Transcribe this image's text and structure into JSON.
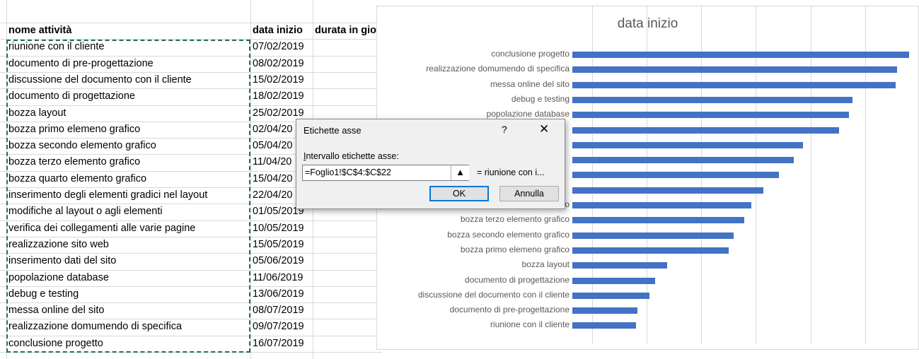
{
  "sheet": {
    "col_a_header": "nome attività",
    "col_c_header": "data inizio",
    "col_d_header": "durata in gio",
    "rows": [
      {
        "name": "riunione con il cliente",
        "date": "07/02/2019"
      },
      {
        "name": "documento di pre-progettazione",
        "date": "08/02/2019"
      },
      {
        "name": "discussione del documento con il cliente",
        "date": "15/02/2019"
      },
      {
        "name": "documento di progettazione",
        "date": "18/02/2019"
      },
      {
        "name": "bozza layout",
        "date": "25/02/2019"
      },
      {
        "name": "bozza primo elemeno grafico",
        "date": "02/04/20"
      },
      {
        "name": "bozza secondo elemento grafico",
        "date": "05/04/20"
      },
      {
        "name": "bozza terzo elemento grafico",
        "date": "11/04/20"
      },
      {
        "name": "bozza quarto elemento grafico",
        "date": "15/04/20"
      },
      {
        "name": "inserimento degli elementi gradici nel layout",
        "date": "22/04/20"
      },
      {
        "name": "modifiche al layout o agli elementi",
        "date": "01/05/2019"
      },
      {
        "name": "verifica dei collegamenti alle varie pagine",
        "date": "10/05/2019"
      },
      {
        "name": "realizzazione sito web",
        "date": "15/05/2019"
      },
      {
        "name": "inserimento dati del sito",
        "date": "05/06/2019"
      },
      {
        "name": "popolazione database",
        "date": "11/06/2019"
      },
      {
        "name": "debug e testing",
        "date": "13/06/2019"
      },
      {
        "name": "messa online del sito",
        "date": "08/07/2019"
      },
      {
        "name": "realizzazione domumendo di specifica",
        "date": "09/07/2019"
      },
      {
        "name": "conclusione progetto",
        "date": "16/07/2019"
      }
    ]
  },
  "chart_data": {
    "type": "bar",
    "title": "data inizio",
    "categories_top_to_bottom": [
      "conclusione progetto",
      "realizzazione domumendo di specifica",
      "messa online del sito",
      "debug e testing",
      "popolazione database",
      "inserimento dati del sito",
      "realizzazione sito web",
      "verifica dei collegamenti alle varie pagine",
      "modifiche al layout o agli elementi",
      "inserimento degli elementi gradici nel layout",
      "bozza quarto elemento grafico",
      "bozza terzo elemento grafico",
      "bozza secondo elemento grafico",
      "bozza primo elemeno grafico",
      "bozza layout",
      "documento di progettazione",
      "discussione del documento con il cliente",
      "documento di pre-progettazione",
      "riunione con il cliente"
    ],
    "visible_labels": [
      "conclusione progetto",
      "realizzazione domumendo di specifica",
      "messa online del sito",
      "debug e testing",
      "popolazione database",
      "",
      "",
      "",
      "",
      "",
      "bozza quarto elemento grafico",
      "bozza terzo elemento grafico",
      "bozza secondo elemento grafico",
      "bozza primo elemeno grafico",
      "bozza layout",
      "documento di progettazione",
      "discussione del documento con il cliente",
      "documento di pre-progettazione",
      "riunione con il cliente"
    ],
    "values": [
      "2019-07-16",
      "2019-07-09",
      "2019-07-08",
      "2019-06-13",
      "2019-06-11",
      "2019-06-05",
      "2019-05-15",
      "2019-05-10",
      "2019-05-01",
      "2019-04-22",
      "2019-04-15",
      "2019-04-11",
      "2019-04-05",
      "2019-04-02",
      "2019-02-25",
      "2019-02-18",
      "2019-02-15",
      "2019-02-08",
      "2019-02-07"
    ],
    "grid": true
  },
  "dialog": {
    "title": "Etichette asse",
    "help": "?",
    "close": "✕",
    "range_label": "Intervallo etichette asse:",
    "range_value": "=Foglio1!$C$4:$C$22",
    "collapse_icon": "▲",
    "preview": "= riunione con i...",
    "ok_label": "OK",
    "cancel_label": "Annulla"
  }
}
